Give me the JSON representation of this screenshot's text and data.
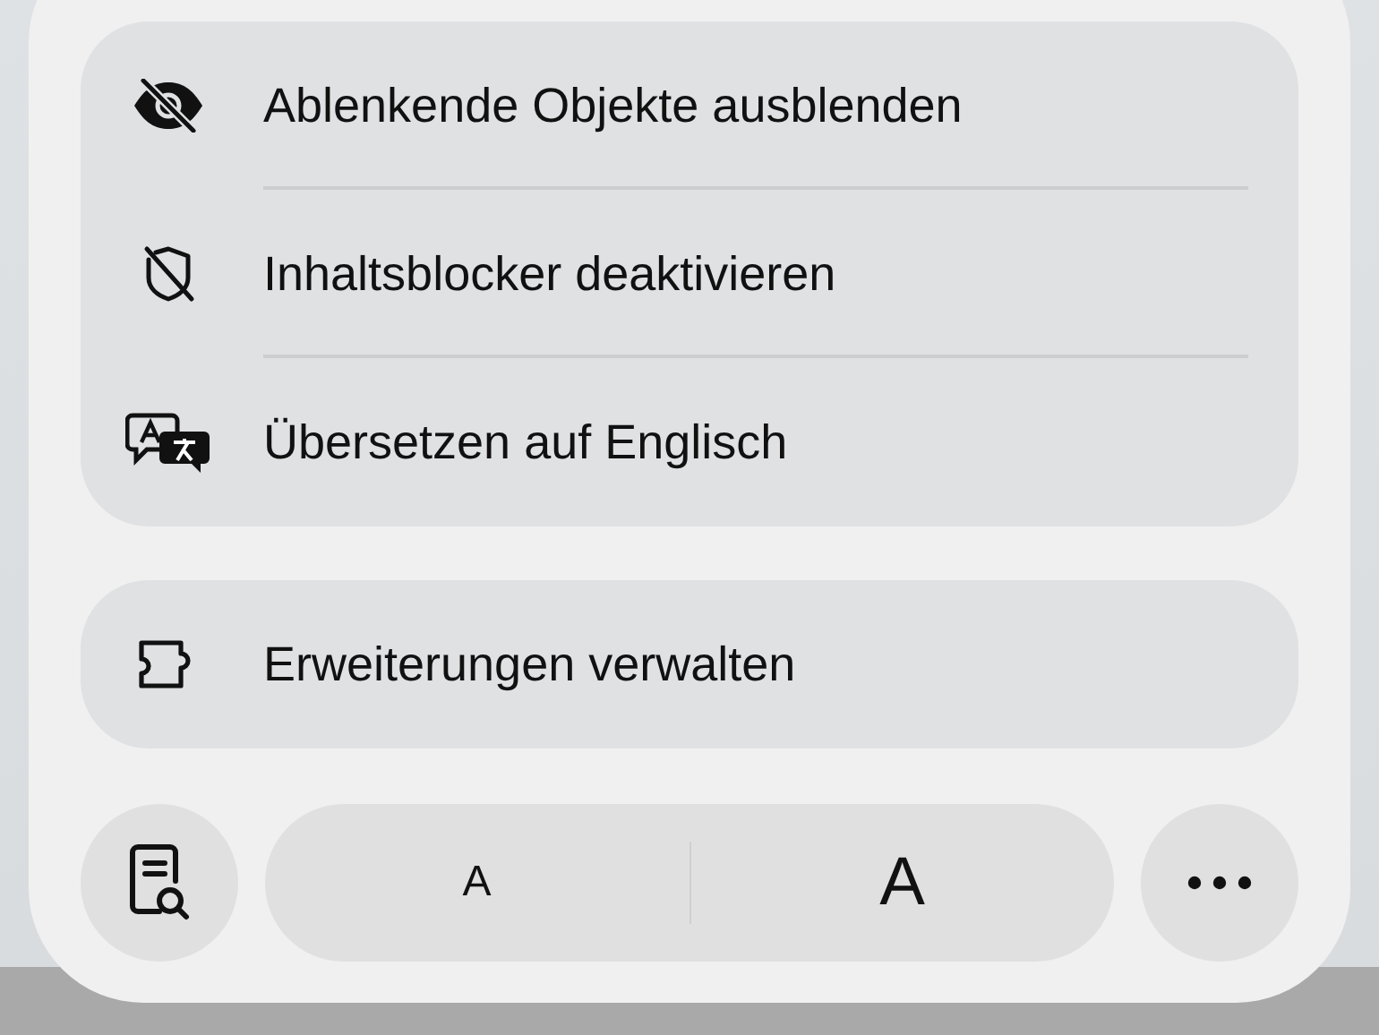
{
  "menu_groups": [
    {
      "items": [
        {
          "label": "Ablenkende Objekte ausblenden",
          "kind": "hide"
        },
        {
          "label": "Inhaltsblocker deaktivieren",
          "kind": "blocker"
        },
        {
          "label": "Übersetzen auf Englisch",
          "kind": "translate"
        }
      ]
    },
    {
      "items": [
        {
          "label": "Erweiterungen verwalten",
          "kind": "extensions"
        }
      ]
    }
  ],
  "toolbar": {
    "text_size": [
      {
        "label": "A",
        "kind": "smaller"
      },
      {
        "label": "A",
        "kind": "larger"
      }
    ]
  }
}
